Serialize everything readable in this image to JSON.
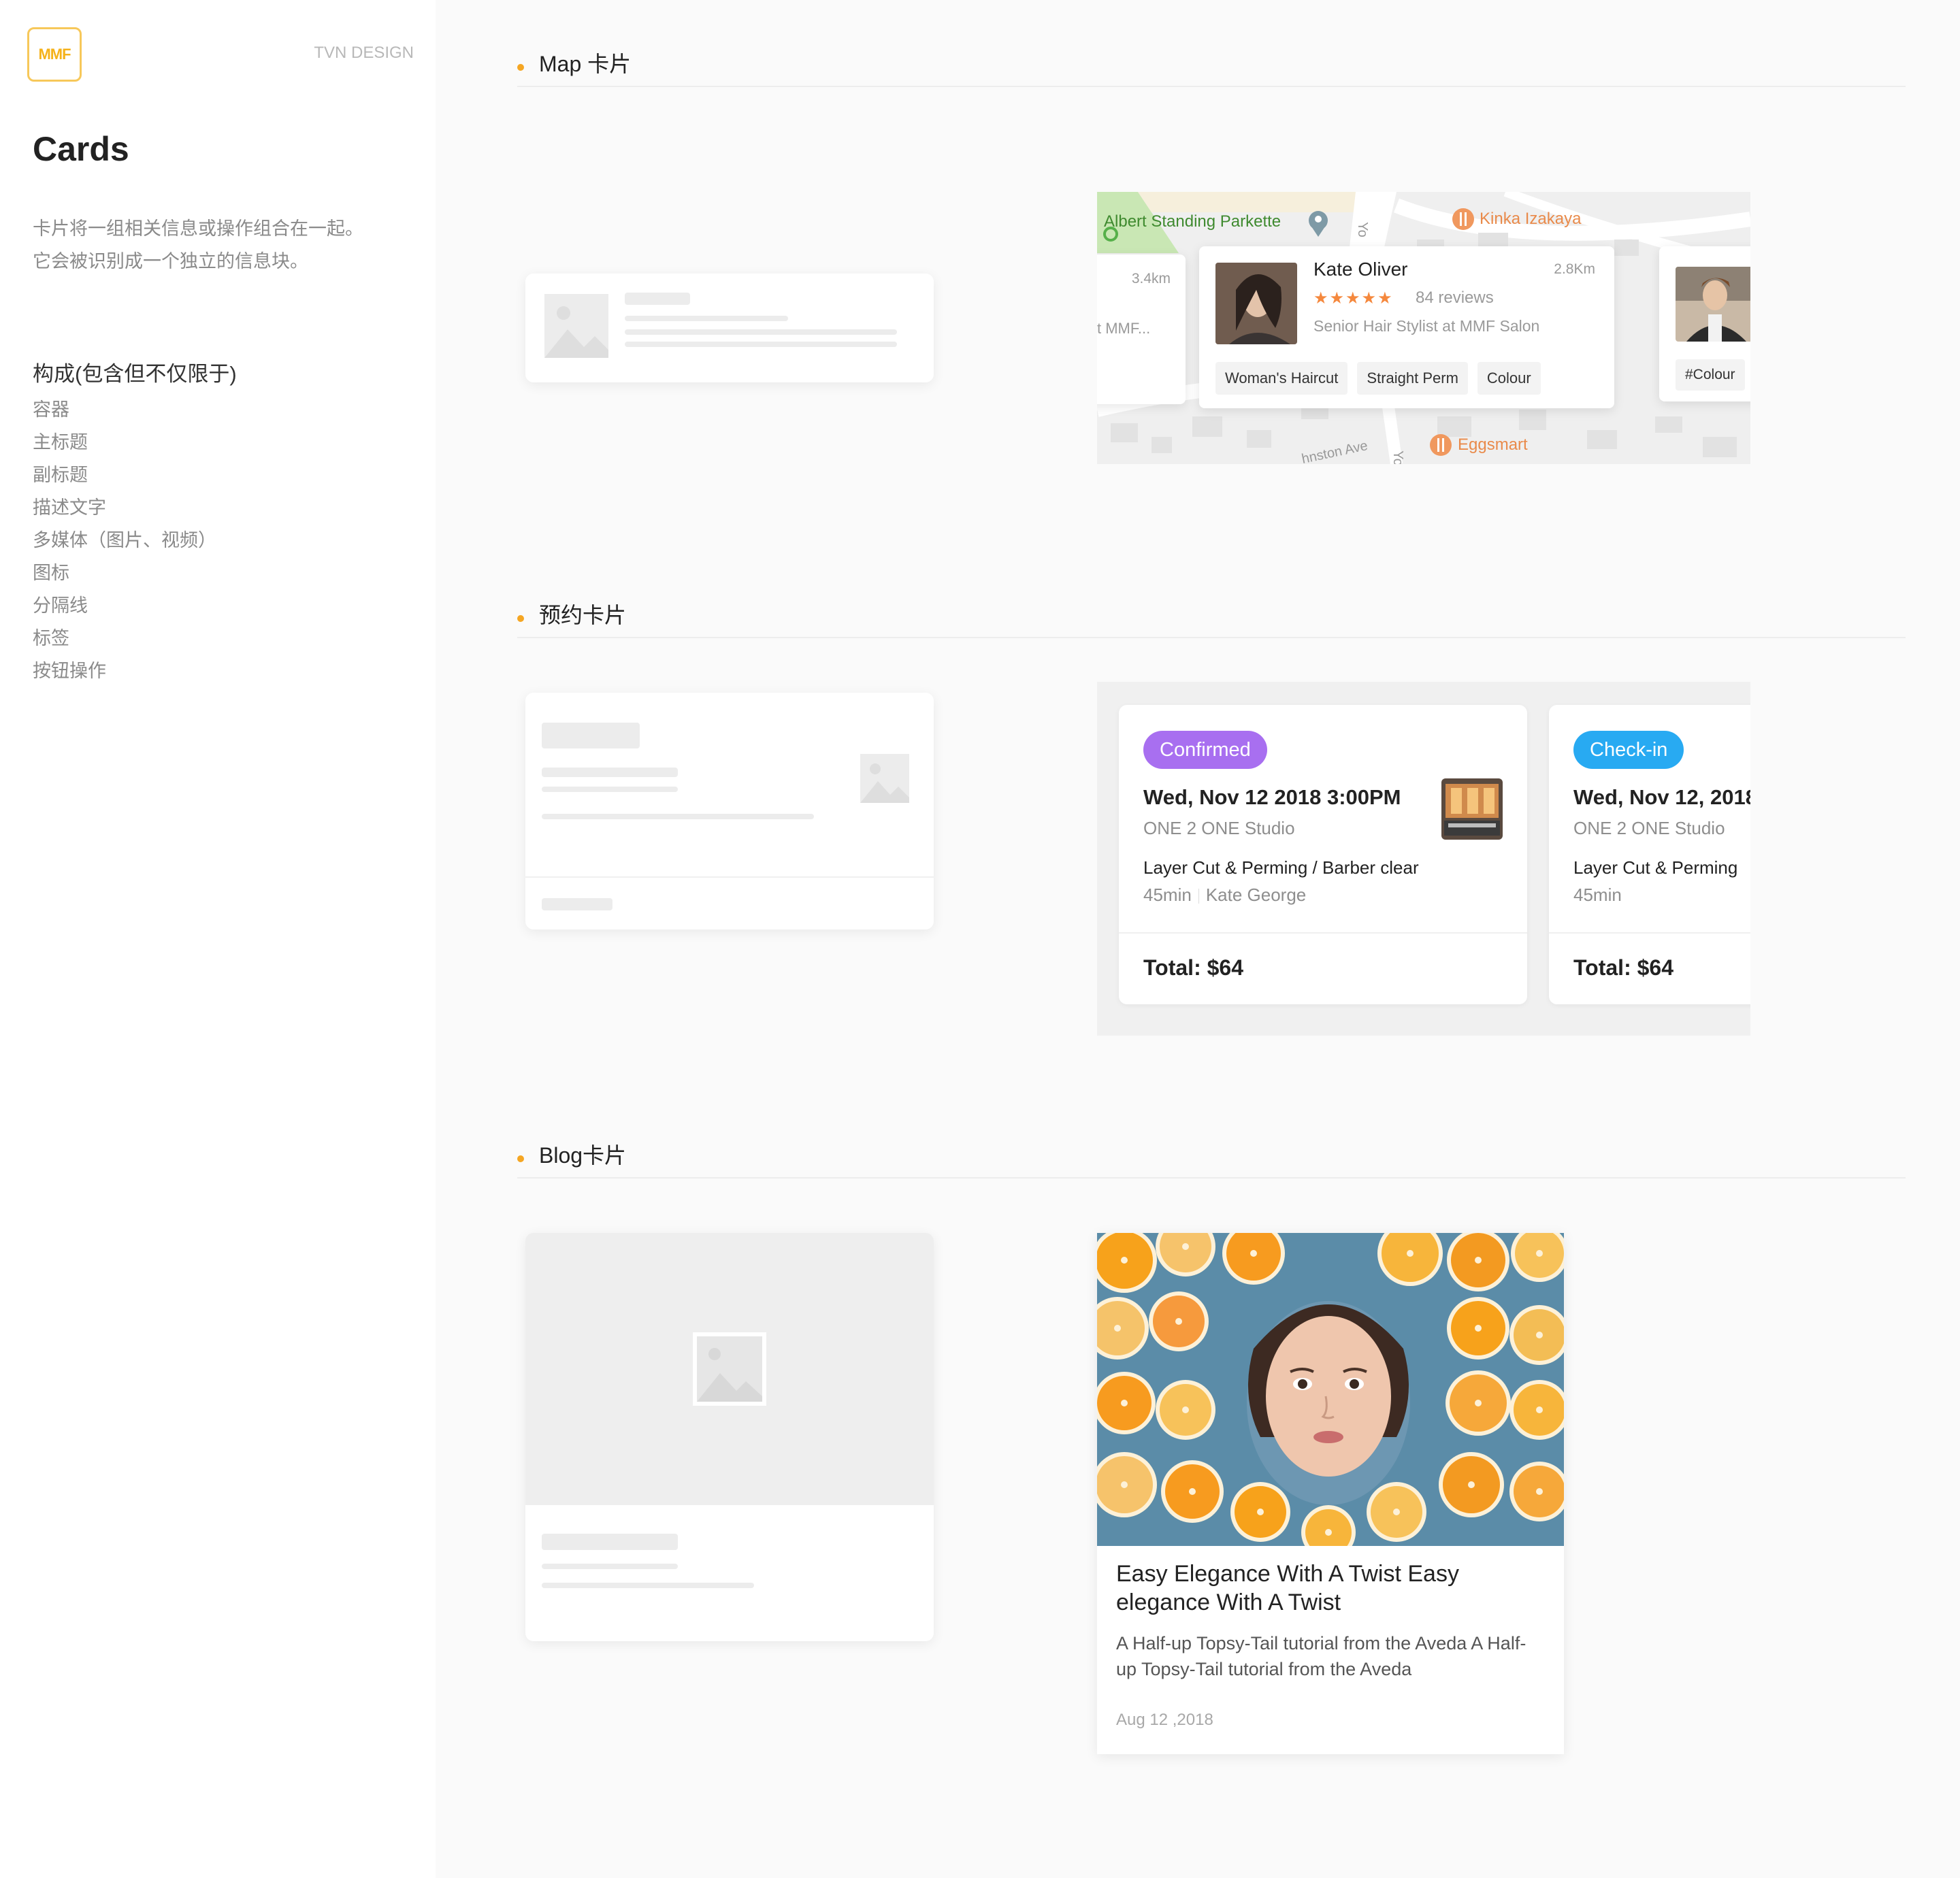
{
  "sidebar": {
    "logo": "MMF",
    "brand": "TVN DESIGN",
    "title": "Cards",
    "desc_line1": "卡片将一组相关信息或操作组合在一起。",
    "desc_line2": "它会被识别成一个独立的信息块。",
    "composition_title": "构成(包含但不仅限于)",
    "composition": [
      "容器",
      "主标题",
      "副标题",
      "描述文字",
      "多媒体（图片、视频）",
      "图标",
      "分隔线",
      "标签",
      "按钮操作"
    ]
  },
  "sections": {
    "map": "Map 卡片",
    "booking": "预约卡片",
    "blog": "Blog卡片"
  },
  "map_card": {
    "poi_park": "Albert Standing Parkette",
    "poi_restaurant": "Kinka Izakaya",
    "poi_eggsmart": "Eggsmart",
    "street_1": "Yo",
    "street_2": "hnston Ave",
    "street_3": "Yo",
    "left_card": {
      "distance": "3.4km",
      "text": "t MMF..."
    },
    "main": {
      "name": "Kate Oliver",
      "distance": "2.8Km",
      "stars": "★★★★★",
      "rating": 5,
      "reviews": "84 reviews",
      "role": "Senior Hair Stylist at MMF Salon",
      "tags": [
        "Woman's Haircut",
        "Straight Perm",
        "Colour"
      ]
    },
    "right_card": {
      "tag": "#Colour"
    }
  },
  "booking_cards": [
    {
      "status": "Confirmed",
      "date": "Wed, Nov 12 2018 3:00PM",
      "studio": "ONE 2 ONE Studio",
      "service": "Layer Cut & Perming / Barber clear",
      "duration": "45min",
      "stylist": "Kate George",
      "total": "Total: $64"
    },
    {
      "status": "Check-in",
      "date": "Wed, Nov 12, 2018",
      "studio": "ONE 2 ONE Studio",
      "service": "Layer Cut & Perming",
      "duration": "45min",
      "total": "Total: $64"
    }
  ],
  "blog_card": {
    "title": "Easy Elegance With A Twist Easy elegance With A Twist",
    "desc": "A Half-up Topsy-Tail tutorial from the Aveda A Half-up Topsy-Tail tutorial from the Aveda",
    "date": "Aug 12 ,2018"
  },
  "colors": {
    "accent": "#f5a623",
    "confirmed": "#a86ff0",
    "checkin": "#28aaf2",
    "star": "#f5883d"
  }
}
